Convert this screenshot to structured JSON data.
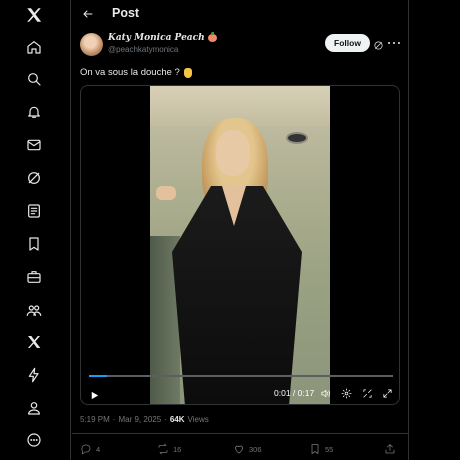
{
  "header": {
    "title": "Post"
  },
  "nav": {
    "items": [
      "x-logo-icon",
      "home-icon",
      "explore-icon",
      "notifications-icon",
      "messages-icon",
      "grok-icon",
      "lists-icon",
      "bookmarks-icon",
      "jobs-icon",
      "communities-icon",
      "premium-icon",
      "verified-orgs-icon",
      "profile-icon",
      "more-icon"
    ]
  },
  "author": {
    "display_name": "Katy Monica Peach",
    "handle": "@peachkatymonica",
    "follow_label": "Follow"
  },
  "tweet": {
    "text": "On va sous la douche ?"
  },
  "video": {
    "time": "0:01 / 0:17",
    "progress": 0.06
  },
  "meta": {
    "time": "5:19 PM",
    "separator": "·",
    "date": "Mar 9, 2025",
    "views_count": "64K",
    "views_label": "Views"
  },
  "actions": {
    "replies": "4",
    "reposts": "16",
    "likes": "306",
    "bookmarks": "55"
  },
  "colors": {
    "accent": "#1d9bf0",
    "background": "#000000",
    "muted": "#71767b",
    "border": "#2f3336"
  }
}
